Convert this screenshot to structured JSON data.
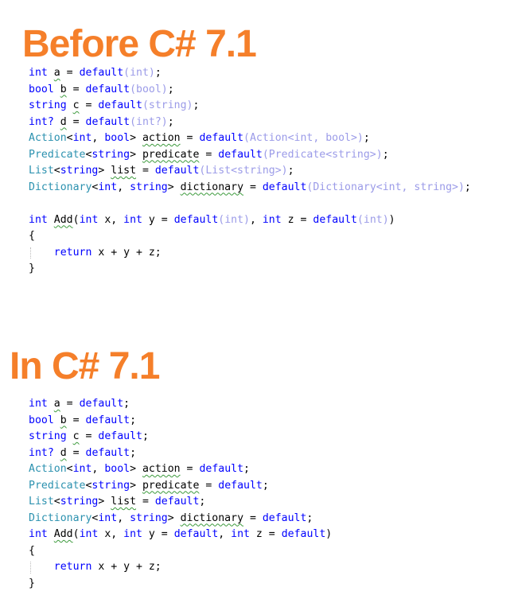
{
  "sections": [
    {
      "title": "Before C# 7.1",
      "lines": [
        [
          {
            "t": "int",
            "c": "kw"
          },
          {
            "t": " "
          },
          {
            "t": "a",
            "c": "sq"
          },
          {
            "t": " = "
          },
          {
            "t": "default",
            "c": "kw"
          },
          {
            "t": "(int)",
            "c": "gray"
          },
          {
            "t": ";"
          }
        ],
        [
          {
            "t": "bool",
            "c": "kw"
          },
          {
            "t": " "
          },
          {
            "t": "b",
            "c": "sq"
          },
          {
            "t": " = "
          },
          {
            "t": "default",
            "c": "kw"
          },
          {
            "t": "(bool)",
            "c": "gray"
          },
          {
            "t": ";"
          }
        ],
        [
          {
            "t": "string",
            "c": "kw"
          },
          {
            "t": " "
          },
          {
            "t": "c",
            "c": "sq"
          },
          {
            "t": " = "
          },
          {
            "t": "default",
            "c": "kw"
          },
          {
            "t": "(string)",
            "c": "gray"
          },
          {
            "t": ";"
          }
        ],
        [
          {
            "t": "int?",
            "c": "kw"
          },
          {
            "t": " "
          },
          {
            "t": "d",
            "c": "sq"
          },
          {
            "t": " = "
          },
          {
            "t": "default",
            "c": "kw"
          },
          {
            "t": "(int?)",
            "c": "gray"
          },
          {
            "t": ";"
          }
        ],
        [
          {
            "t": "Action",
            "c": "ty"
          },
          {
            "t": "<"
          },
          {
            "t": "int",
            "c": "kw"
          },
          {
            "t": ", "
          },
          {
            "t": "bool",
            "c": "kw"
          },
          {
            "t": "> "
          },
          {
            "t": "action",
            "c": "sq"
          },
          {
            "t": " = "
          },
          {
            "t": "default",
            "c": "kw"
          },
          {
            "t": "(Action<int, bool>)",
            "c": "gray"
          },
          {
            "t": ";"
          }
        ],
        [
          {
            "t": "Predicate",
            "c": "ty"
          },
          {
            "t": "<"
          },
          {
            "t": "string",
            "c": "kw"
          },
          {
            "t": "> "
          },
          {
            "t": "predicate",
            "c": "sq"
          },
          {
            "t": " = "
          },
          {
            "t": "default",
            "c": "kw"
          },
          {
            "t": "(Predicate<string>)",
            "c": "gray"
          },
          {
            "t": ";"
          }
        ],
        [
          {
            "t": "List",
            "c": "ty"
          },
          {
            "t": "<"
          },
          {
            "t": "string",
            "c": "kw"
          },
          {
            "t": "> "
          },
          {
            "t": "list",
            "c": "sq"
          },
          {
            "t": " = "
          },
          {
            "t": "default",
            "c": "kw"
          },
          {
            "t": "(List<string>)",
            "c": "gray"
          },
          {
            "t": ";"
          }
        ],
        [
          {
            "t": "Dictionary",
            "c": "ty"
          },
          {
            "t": "<"
          },
          {
            "t": "int",
            "c": "kw"
          },
          {
            "t": ", "
          },
          {
            "t": "string",
            "c": "kw"
          },
          {
            "t": "> "
          },
          {
            "t": "dictionary",
            "c": "sq"
          },
          {
            "t": " = "
          },
          {
            "t": "default",
            "c": "kw"
          },
          {
            "t": "(Dictionary<int, string>)",
            "c": "gray"
          },
          {
            "t": ";"
          }
        ],
        [],
        [
          {
            "t": "int",
            "c": "kw"
          },
          {
            "t": " "
          },
          {
            "t": "Add",
            "c": "sq"
          },
          {
            "t": "("
          },
          {
            "t": "int",
            "c": "kw"
          },
          {
            "t": " x, "
          },
          {
            "t": "int",
            "c": "kw"
          },
          {
            "t": " y = "
          },
          {
            "t": "default",
            "c": "kw"
          },
          {
            "t": "(int)",
            "c": "gray"
          },
          {
            "t": ", "
          },
          {
            "t": "int",
            "c": "kw"
          },
          {
            "t": " z = "
          },
          {
            "t": "default",
            "c": "kw"
          },
          {
            "t": "(int)",
            "c": "gray"
          },
          {
            "t": ")"
          }
        ],
        [
          {
            "t": "{"
          }
        ],
        [
          {
            "t": "    "
          },
          {
            "t": "return",
            "c": "kw"
          },
          {
            "t": " x + y + z;"
          }
        ],
        [
          {
            "t": "}"
          }
        ]
      ]
    },
    {
      "title": "In C# 7.1",
      "lines": [
        [
          {
            "t": "int",
            "c": "kw"
          },
          {
            "t": " "
          },
          {
            "t": "a",
            "c": "sq"
          },
          {
            "t": " = "
          },
          {
            "t": "default",
            "c": "kw"
          },
          {
            "t": ";"
          }
        ],
        [
          {
            "t": "bool",
            "c": "kw"
          },
          {
            "t": " "
          },
          {
            "t": "b",
            "c": "sq"
          },
          {
            "t": " = "
          },
          {
            "t": "default",
            "c": "kw"
          },
          {
            "t": ";"
          }
        ],
        [
          {
            "t": "string",
            "c": "kw"
          },
          {
            "t": " "
          },
          {
            "t": "c",
            "c": "sq"
          },
          {
            "t": " = "
          },
          {
            "t": "default",
            "c": "kw"
          },
          {
            "t": ";"
          }
        ],
        [
          {
            "t": "int?",
            "c": "kw"
          },
          {
            "t": " "
          },
          {
            "t": "d",
            "c": "sq"
          },
          {
            "t": " = "
          },
          {
            "t": "default",
            "c": "kw"
          },
          {
            "t": ";"
          }
        ],
        [
          {
            "t": "Action",
            "c": "ty"
          },
          {
            "t": "<"
          },
          {
            "t": "int",
            "c": "kw"
          },
          {
            "t": ", "
          },
          {
            "t": "bool",
            "c": "kw"
          },
          {
            "t": "> "
          },
          {
            "t": "action",
            "c": "sq"
          },
          {
            "t": " = "
          },
          {
            "t": "default",
            "c": "kw"
          },
          {
            "t": ";"
          }
        ],
        [
          {
            "t": "Predicate",
            "c": "ty"
          },
          {
            "t": "<"
          },
          {
            "t": "string",
            "c": "kw"
          },
          {
            "t": "> "
          },
          {
            "t": "predicate",
            "c": "sq"
          },
          {
            "t": " = "
          },
          {
            "t": "default",
            "c": "kw"
          },
          {
            "t": ";"
          }
        ],
        [
          {
            "t": "List",
            "c": "ty"
          },
          {
            "t": "<"
          },
          {
            "t": "string",
            "c": "kw"
          },
          {
            "t": "> "
          },
          {
            "t": "list",
            "c": "sq"
          },
          {
            "t": " = "
          },
          {
            "t": "default",
            "c": "kw"
          },
          {
            "t": ";"
          }
        ],
        [
          {
            "t": "Dictionary",
            "c": "ty"
          },
          {
            "t": "<"
          },
          {
            "t": "int",
            "c": "kw"
          },
          {
            "t": ", "
          },
          {
            "t": "string",
            "c": "kw"
          },
          {
            "t": "> "
          },
          {
            "t": "dictionary",
            "c": "sq"
          },
          {
            "t": " = "
          },
          {
            "t": "default",
            "c": "kw"
          },
          {
            "t": ";"
          }
        ],
        [
          {
            "t": "int",
            "c": "kw"
          },
          {
            "t": " "
          },
          {
            "t": "Add",
            "c": "sq"
          },
          {
            "t": "("
          },
          {
            "t": "int",
            "c": "kw"
          },
          {
            "t": " x, "
          },
          {
            "t": "int",
            "c": "kw"
          },
          {
            "t": " y = "
          },
          {
            "t": "default",
            "c": "kw"
          },
          {
            "t": ", "
          },
          {
            "t": "int",
            "c": "kw"
          },
          {
            "t": " z = "
          },
          {
            "t": "default",
            "c": "kw"
          },
          {
            "t": ")"
          }
        ],
        [
          {
            "t": "{"
          }
        ],
        [
          {
            "t": "    "
          },
          {
            "t": "return",
            "c": "kw"
          },
          {
            "t": " x + y + z;"
          }
        ],
        [
          {
            "t": "}"
          }
        ]
      ]
    }
  ],
  "colors": {
    "heading": "#f57f2a",
    "keyword": "#0000ff",
    "type": "#2b91af",
    "redundant": "#9b9be8",
    "squiggle": "#3c9a3c"
  }
}
